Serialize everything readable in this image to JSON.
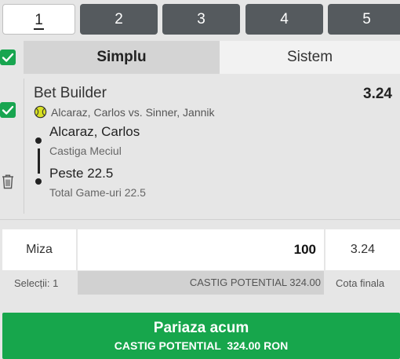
{
  "page_tabs": [
    {
      "label": "1",
      "active": true
    },
    {
      "label": "2",
      "active": false
    },
    {
      "label": "3",
      "active": false
    },
    {
      "label": "4",
      "active": false
    },
    {
      "label": "5",
      "active": false
    }
  ],
  "mode_tabs": {
    "single": "Simplu",
    "system": "Sistem"
  },
  "bet": {
    "title": "Bet Builder",
    "odds": "3.24",
    "match": "Alcaraz, Carlos vs. Sinner, Jannik",
    "legs": [
      {
        "selection": "Alcaraz, Carlos",
        "market": "Castiga Meciul"
      },
      {
        "selection": "Peste 22.5",
        "market": "Total Game-uri 22.5"
      }
    ]
  },
  "stake": {
    "label": "Miza",
    "value": "100",
    "total_odds": "3.24",
    "selections_text": "Selecții: 1",
    "potential_win_text": "CASTIG POTENTIAL 324.00",
    "final_odds_label": "Cota finala"
  },
  "place_bet": {
    "label": "Pariaza acum",
    "potential_text": "CASTIG POTENTIAL  324.00 RON"
  },
  "colors": {
    "accent_green": "#17a64c",
    "tab_dark": "#555a5e",
    "panel_bg": "#e6e6e6"
  },
  "icons": {
    "checkbox": "checkbox-checked-icon",
    "sport": "tennis-ball-icon",
    "delete": "trash-icon"
  }
}
